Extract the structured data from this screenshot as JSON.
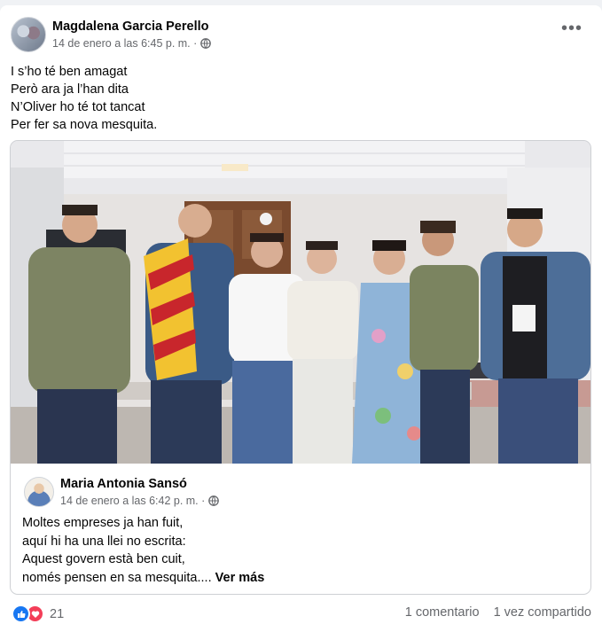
{
  "post": {
    "author": "Magdalena Garcia Perello",
    "timestamp": "14 de enero a las 6:45 p. m. ·",
    "privacy_icon": "globe-icon",
    "menu_label": "•••",
    "poem": [
      "I s’ho té ben amagat",
      "Però ara ja l’han dita",
      "N’Oliver ho té tot tancat",
      "Per fer sa nova mesquita."
    ]
  },
  "shared_post": {
    "author": "Maria Antonia Sansó",
    "timestamp": "14 de enero a las 6:42 p. m. ·",
    "lines": [
      "Moltes empreses ja han fuit,",
      "aquí hi ha una llei no escrita:",
      "Aquest govern està ben cuit,",
      "només pensen en sa mesquita...."
    ],
    "see_more": "Ver más"
  },
  "footer": {
    "reaction_count": "21",
    "comments": "1 comentario",
    "shares": "1 vez compartido"
  },
  "colors": {
    "primary_text": "#050505",
    "secondary_text": "#65676b",
    "like_blue": "#1877f2",
    "love_red": "#f33e58"
  }
}
